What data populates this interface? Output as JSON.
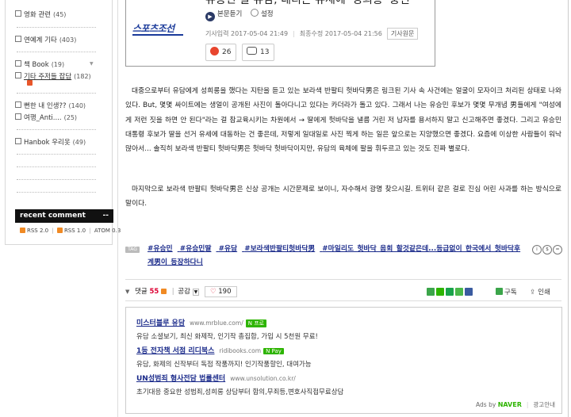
{
  "sidebar": {
    "categories": [
      {
        "label": "영화 관련",
        "count": "(45)"
      },
      {
        "label": "연예계 기타",
        "count": "(403)"
      },
      {
        "label": "책 Book",
        "count": "(19)"
      },
      {
        "label": "기타 주저들 잡담",
        "count": "(182)"
      },
      {
        "label": "뻔한 내 인생??",
        "count": "(140)"
      },
      {
        "label": "여행_Anti....",
        "count": "(25)"
      },
      {
        "label": "Hanbok 우리옷",
        "count": "(49)"
      }
    ],
    "recent_comment": "recent comment",
    "recent_more": "--",
    "rss2": "RSS 2.0",
    "rss1": "RSS 1.0",
    "atom": "ATOM 0.3"
  },
  "article": {
    "logo": "스포츠조선",
    "title": "유승민 딸 유담, 네티즌 유세에 '성희롱' 충언",
    "listen": "본문듣기",
    "setting": "설정",
    "input_time": "기사입력 2017-05-04 21:49",
    "edit_time": "최종수정 2017-05-04 21:56",
    "source": "기사원문",
    "angry_count": "26",
    "comment_count": "13"
  },
  "body": {
    "p1": "대중으로부터 유담에게 성희롱을 했다는 지탄을 듣고 있는 보라색 반팔티 헛바닥男은 링크된 기사 속 사건에는 얼굴이 모자이크 처리된 상태로 나와 있다. But, 몇몇 싸이트에는 생얼이 공개된 사진이 돌아다니고 있다는 카더라가 돌고 있다. 그래서 나는 유승민 후보가 몇몇 무개념 男들에게 \"여성에게 저런 짓을 하면 안 된다\"라는 걸 참교육시키는 차원에서 → 딸에게 헛바닥을 낼름 거린 저 남자를 용서하지 말고 신고해주면 좋겠다. 그리고 유승민 대통령 후보가 딸을 선거 유세에 대동하는 건 좋은데, 저렇게 일대일로 사진 찍게 하는 일은 앞으로는 지양했으면 좋겠다. 요즘에 이상한 사람들이 워낙 많아서... 솔직히 보라색 반팔티 헛바닥男은 헛바닥 헛바닥이지만, 유담의 육체에 팔을 휘두르고 있는 것도 진짜 별로다.",
    "p2": "마지막으로 보라색 반팔티 헛바닥男은 신상 공개는 시간문제로 보이니, 자수해서 광명 찾으시길. 트위터 같은 걸로 진심 어린 사과를 하는 방식으로 말이다."
  },
  "tags": [
    "#유승민",
    "#유승민딸",
    "#유담",
    "#보라색반팔티헛바닥男",
    "#마일리도_헛바닥_음회_할것같은데...등급없이_한국에서_헛바닥후계男이_등장하다니"
  ],
  "comment_bar": {
    "label": "댓글",
    "count": "55",
    "sympathy": "공감",
    "likes": "190",
    "subscribe": "구독",
    "print": "인쇄"
  },
  "ads": [
    {
      "title": "미스터블루 유담",
      "url": "www.mrblue.com/",
      "badge": "N 프로",
      "desc": "유담 소셜보기, 최신 화제작, 인기작 총집합, 가입 시 5천원 무료!"
    },
    {
      "title": "1등 전자책 서점 리디북스",
      "url": "ridibooks.com",
      "badge": "N Pay",
      "desc": "유담, 화제의 신작부터 독점 작품까지! 인기작품할인, 대여가능"
    },
    {
      "title": "UN성범죄 형사전담 법률센터",
      "url": "www.unsolution.co.kr/",
      "badge": "",
      "desc": "초기대응 중요한 성범죄,성희롱 상담부터 합의,무죄등,변호사직접무료상담"
    }
  ],
  "ads_footer": {
    "ads_by": "Ads by",
    "naver": "NAVER",
    "info": "광고안내"
  },
  "colors": {
    "link": "#1a2a8a",
    "accent": "#e8452e",
    "naver": "#2db400"
  }
}
